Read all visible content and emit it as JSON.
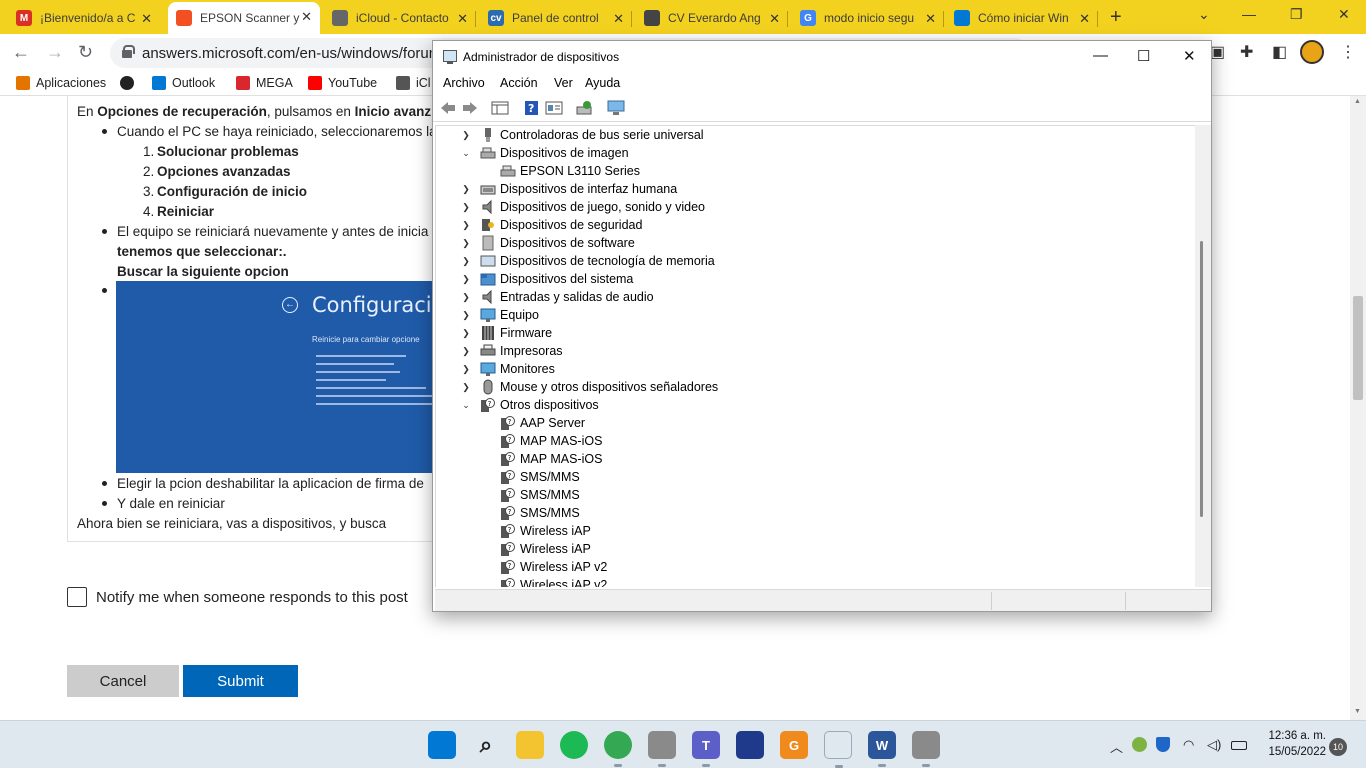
{
  "browser": {
    "tabs": [
      {
        "title": "¡Bienvenido/a a C",
        "icon": "gmail-icon",
        "color": "#d93025",
        "glyph": "M"
      },
      {
        "title": "EPSON Scanner y",
        "icon": "microsoft-icon",
        "color": "#f25022",
        "glyph": ""
      },
      {
        "title": "iCloud - Contacto",
        "icon": "apple-icon",
        "color": "#666666",
        "glyph": ""
      },
      {
        "title": "Panel de control",
        "icon": "cv-icon",
        "color": "#2b6cb0",
        "glyph": "cv"
      },
      {
        "title": "CV Everardo Ang",
        "icon": "globe-icon",
        "color": "#444444",
        "glyph": ""
      },
      {
        "title": "modo inicio segu",
        "icon": "google-icon",
        "color": "#4285f4",
        "glyph": "G"
      },
      {
        "title": "Cómo iniciar Win",
        "icon": "windows-icon",
        "color": "#0078d4",
        "glyph": ""
      }
    ],
    "url": "answers.microsoft.com/en-us/windows/forum/a",
    "bookmarks": [
      {
        "label": "Aplicaciones",
        "icon": "apps-grid-icon"
      },
      {
        "label": "",
        "icon": "globe-icon"
      },
      {
        "label": "Outlook",
        "icon": "outlook-icon"
      },
      {
        "label": "MEGA",
        "icon": "mega-icon"
      },
      {
        "label": "YouTube",
        "icon": "youtube-icon"
      },
      {
        "label": "iCl",
        "icon": "apple-icon"
      }
    ]
  },
  "post": {
    "line1_pre": "En ",
    "line1_b1": "Opciones de recuperación",
    "line1_mid": ", pulsamos en ",
    "line1_b2": "Inicio avanz",
    "bullet1": "Cuando el PC se haya reiniciado, seleccionaremos la",
    "steps": [
      "Solucionar problemas",
      "Opciones avanzadas",
      "Configuración de inicio",
      "Reiniciar"
    ],
    "bullet2": "El equipo se reiniciará nuevamente y antes de inicia",
    "bold_line1": "tenemos que seleccionar:.",
    "bold_line2": "Buscar la siguiente opcion",
    "screenshot_title": "Configuración",
    "screenshot_sub": "Reinicie para cambiar opcione",
    "bullet3": "Elegir la pcion deshabilitar la aplicacion de firma de",
    "bullet4": "Y dale en reiniciar",
    "closing": "Ahora bien se reiniciara, vas a dispositivos, y busca"
  },
  "form": {
    "notify_label": "Notify me when someone responds to this post",
    "notify_checked": false,
    "cancel": "Cancel",
    "submit": "Submit"
  },
  "device_manager": {
    "title": "Administrador de dispositivos",
    "menu": [
      "Archivo",
      "Acción",
      "Ver",
      "Ayuda"
    ],
    "tree": [
      {
        "label": "Controladoras de bus serie universal",
        "level": 0,
        "state": "collapsed",
        "icon": "usb-icon"
      },
      {
        "label": "Dispositivos de imagen",
        "level": 0,
        "state": "expanded",
        "icon": "scanner-icon"
      },
      {
        "label": "EPSON L3110 Series",
        "level": 1,
        "state": "leaf",
        "icon": "scanner-icon"
      },
      {
        "label": "Dispositivos de interfaz humana",
        "level": 0,
        "state": "collapsed",
        "icon": "keyboard-icon"
      },
      {
        "label": "Dispositivos de juego, sonido y video",
        "level": 0,
        "state": "collapsed",
        "icon": "speaker-icon"
      },
      {
        "label": "Dispositivos de seguridad",
        "level": 0,
        "state": "collapsed",
        "icon": "security-key-icon"
      },
      {
        "label": "Dispositivos de software",
        "level": 0,
        "state": "collapsed",
        "icon": "software-device-icon"
      },
      {
        "label": "Dispositivos de tecnología de memoria",
        "level": 0,
        "state": "collapsed",
        "icon": "memory-icon"
      },
      {
        "label": "Dispositivos del sistema",
        "level": 0,
        "state": "collapsed",
        "icon": "system-folder-icon"
      },
      {
        "label": "Entradas y salidas de audio",
        "level": 0,
        "state": "collapsed",
        "icon": "speaker-icon"
      },
      {
        "label": "Equipo",
        "level": 0,
        "state": "collapsed",
        "icon": "monitor-icon"
      },
      {
        "label": "Firmware",
        "level": 0,
        "state": "collapsed",
        "icon": "chip-icon"
      },
      {
        "label": "Impresoras",
        "level": 0,
        "state": "collapsed",
        "icon": "printer-icon"
      },
      {
        "label": "Monitores",
        "level": 0,
        "state": "collapsed",
        "icon": "monitor-icon"
      },
      {
        "label": "Mouse y otros dispositivos señaladores",
        "level": 0,
        "state": "collapsed",
        "icon": "mouse-icon"
      },
      {
        "label": "Otros dispositivos",
        "level": 0,
        "state": "expanded",
        "icon": "unknown-device-icon"
      },
      {
        "label": "AAP Server",
        "level": 1,
        "state": "leaf",
        "icon": "unknown-device-icon"
      },
      {
        "label": "MAP MAS-iOS",
        "level": 1,
        "state": "leaf",
        "icon": "unknown-device-icon"
      },
      {
        "label": "MAP MAS-iOS",
        "level": 1,
        "state": "leaf",
        "icon": "unknown-device-icon"
      },
      {
        "label": "SMS/MMS",
        "level": 1,
        "state": "leaf",
        "icon": "unknown-device-icon"
      },
      {
        "label": "SMS/MMS",
        "level": 1,
        "state": "leaf",
        "icon": "unknown-device-icon"
      },
      {
        "label": "SMS/MMS",
        "level": 1,
        "state": "leaf",
        "icon": "unknown-device-icon"
      },
      {
        "label": "Wireless iAP",
        "level": 1,
        "state": "leaf",
        "icon": "unknown-device-icon"
      },
      {
        "label": "Wireless iAP",
        "level": 1,
        "state": "leaf",
        "icon": "unknown-device-icon"
      },
      {
        "label": "Wireless iAP v2",
        "level": 1,
        "state": "leaf",
        "icon": "unknown-device-icon"
      },
      {
        "label": "Wireless iAP v2",
        "level": 1,
        "state": "leaf",
        "icon": "unknown-device-icon"
      }
    ]
  },
  "taskbar": {
    "apps": [
      {
        "name": "start",
        "icon": "windows-start-icon",
        "glyph": "",
        "color": "#0078d4"
      },
      {
        "name": "search",
        "icon": "search-icon",
        "glyph": "",
        "color": ""
      },
      {
        "name": "explorer",
        "icon": "folder-icon",
        "glyph": "",
        "color": "#f4c430"
      },
      {
        "name": "spotify",
        "icon": "spotify-icon",
        "glyph": "",
        "color": "#1db954"
      },
      {
        "name": "chrome",
        "icon": "chrome-icon",
        "glyph": "",
        "color": "#34a853"
      },
      {
        "name": "scanner",
        "icon": "scanner-icon",
        "glyph": "",
        "color": "#8a8a8a"
      },
      {
        "name": "teams",
        "icon": "teams-icon",
        "glyph": "T",
        "color": "#5b5fc7"
      },
      {
        "name": "mail",
        "icon": "mail-icon",
        "glyph": "",
        "color": "#1f3a8a"
      },
      {
        "name": "pdf",
        "icon": "pdf-icon",
        "glyph": "G",
        "color": "#f08a1c"
      },
      {
        "name": "devmgr",
        "icon": "device-manager-icon",
        "glyph": "",
        "color": "#4a7ab8"
      },
      {
        "name": "word",
        "icon": "word-icon",
        "glyph": "W",
        "color": "#2b579a"
      },
      {
        "name": "scanner2",
        "icon": "scanner-icon",
        "glyph": "",
        "color": "#8a8a8a"
      }
    ],
    "time": "12:36 a. m.",
    "date": "15/05/2022",
    "notifications": "10"
  },
  "colors": {
    "tabstrip": "#f3d21f",
    "submit": "#0067b8",
    "cancel": "#cccccc",
    "screenshot_blue": "#1f5ba8"
  }
}
